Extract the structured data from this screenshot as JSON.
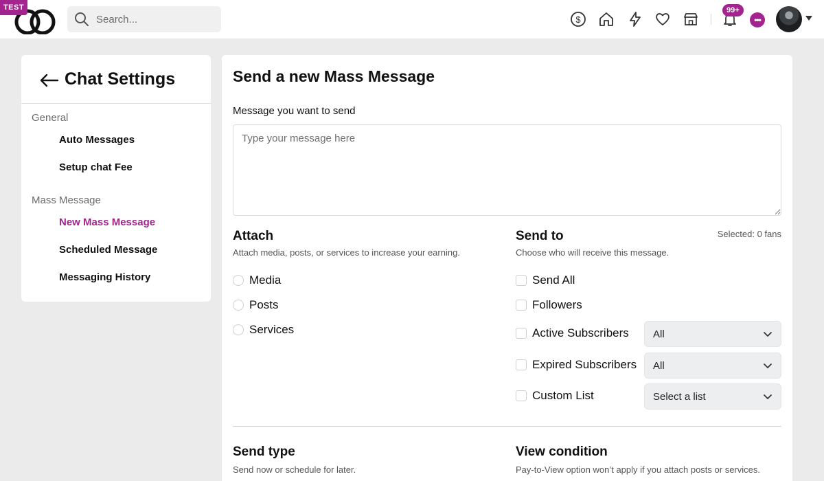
{
  "header": {
    "env_badge": "TEST",
    "search_placeholder": "Search...",
    "notifications_count": "99+",
    "chat_indicator": "•••",
    "icons": [
      "dollar-icon",
      "home-icon",
      "lightning-icon",
      "heart-icon",
      "store-icon",
      "bell-icon",
      "chat-icon"
    ],
    "accent_color": "#a3238f"
  },
  "sidebar": {
    "title": "Chat Settings",
    "sections": [
      {
        "label": "General",
        "items": [
          {
            "label": "Auto Messages"
          },
          {
            "label": "Setup chat Fee"
          }
        ]
      },
      {
        "label": "Mass Message",
        "items": [
          {
            "label": "New Mass Message",
            "active": true
          },
          {
            "label": "Scheduled Message"
          },
          {
            "label": "Messaging History"
          }
        ]
      }
    ]
  },
  "main": {
    "title": "Send a new Mass Message",
    "message_label": "Message you want to send",
    "message_placeholder": "Type your message here",
    "attach": {
      "title": "Attach",
      "subtitle": "Attach media, posts, or services to increase your earning.",
      "options": [
        "Media",
        "Posts",
        "Services"
      ]
    },
    "send_to": {
      "title": "Send to",
      "subtitle": "Choose who will receive this message.",
      "selected": "Selected: 0 fans",
      "options": [
        {
          "label": "Send All"
        },
        {
          "label": "Followers"
        },
        {
          "label": "Active Subscribers",
          "dropdown": "All"
        },
        {
          "label": "Expired Subscribers",
          "dropdown": "All"
        },
        {
          "label": "Custom List",
          "dropdown": "Select a list"
        }
      ]
    },
    "send_type": {
      "title": "Send type",
      "subtitle": "Send now or schedule for later."
    },
    "view_condition": {
      "title": "View condition",
      "subtitle": "Pay-to-View option won’t apply if you attach posts or services."
    }
  }
}
